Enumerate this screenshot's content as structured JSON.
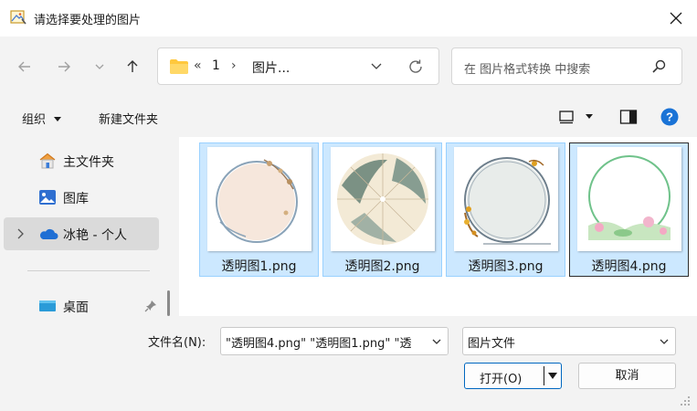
{
  "window": {
    "title": "请选择要处理的图片",
    "app_icon": "image-picker-icon",
    "close_icon": "close-icon"
  },
  "nav": {
    "back_icon": "arrow-left-icon",
    "forward_icon": "arrow-right-icon",
    "recent_icon": "chevron-down-icon",
    "up_icon": "arrow-up-icon",
    "address": {
      "folder_icon": "folder-icon",
      "overflow": "«",
      "crumb1": "1",
      "sep": "›",
      "crumb2": "图片..."
    },
    "refresh_icon": "refresh-icon",
    "search_placeholder": "在 图片格式转换 中搜索"
  },
  "toolbar": {
    "organize": "组织",
    "new_folder": "新建文件夹"
  },
  "sidebar": {
    "items": [
      {
        "label": "主文件夹",
        "icon": "home-icon"
      },
      {
        "label": "图库",
        "icon": "gallery-icon"
      },
      {
        "label": "冰艳 - 个人",
        "icon": "onedrive-cloud-icon"
      },
      {
        "label": "桌面",
        "icon": "desktop-icon"
      }
    ]
  },
  "files": [
    {
      "name": "透明图1.png"
    },
    {
      "name": "透明图2.png"
    },
    {
      "name": "透明图3.png"
    },
    {
      "name": "透明图4.png"
    }
  ],
  "bottom": {
    "filename_label": "文件名(N):",
    "filename_value": "\"透明图4.png\" \"透明图1.png\" \"透",
    "filetype": "图片文件",
    "open": "打开(O)",
    "cancel": "取消"
  },
  "colors": {
    "selection_bg": "#cce8ff",
    "selection_border": "#99d1ff",
    "accent": "#0067c0"
  }
}
